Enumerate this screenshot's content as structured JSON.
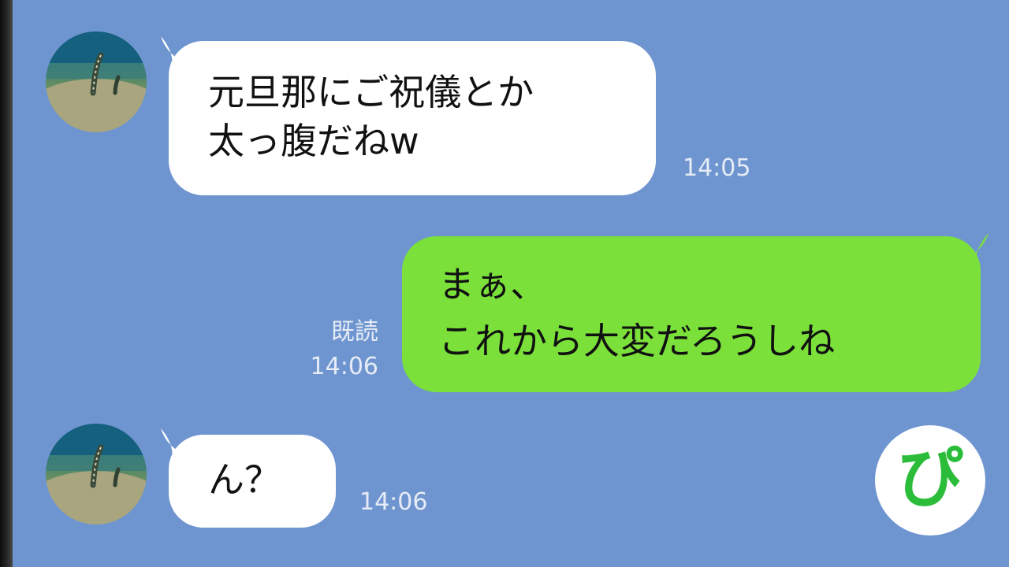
{
  "messages": [
    {
      "side": "in",
      "lines": [
        "元旦那にご祝儀とか",
        "太っ腹だねw"
      ],
      "time": "14:05"
    },
    {
      "side": "out",
      "lines": [
        "まぁ、",
        "これから大変だろうしね"
      ],
      "read": "既読",
      "time": "14:06"
    },
    {
      "side": "in",
      "lines": [
        "ん？"
      ],
      "time": "14:06"
    }
  ],
  "logo": {
    "text": "ぴ"
  },
  "colors": {
    "background": "#6f95d0",
    "incoming_bubble": "#ffffff",
    "outgoing_bubble": "#7be03a",
    "logo_green": "#2bbd3a"
  },
  "icons": [
    "avatar-garden-eel-icon",
    "pi-logo-icon"
  ]
}
